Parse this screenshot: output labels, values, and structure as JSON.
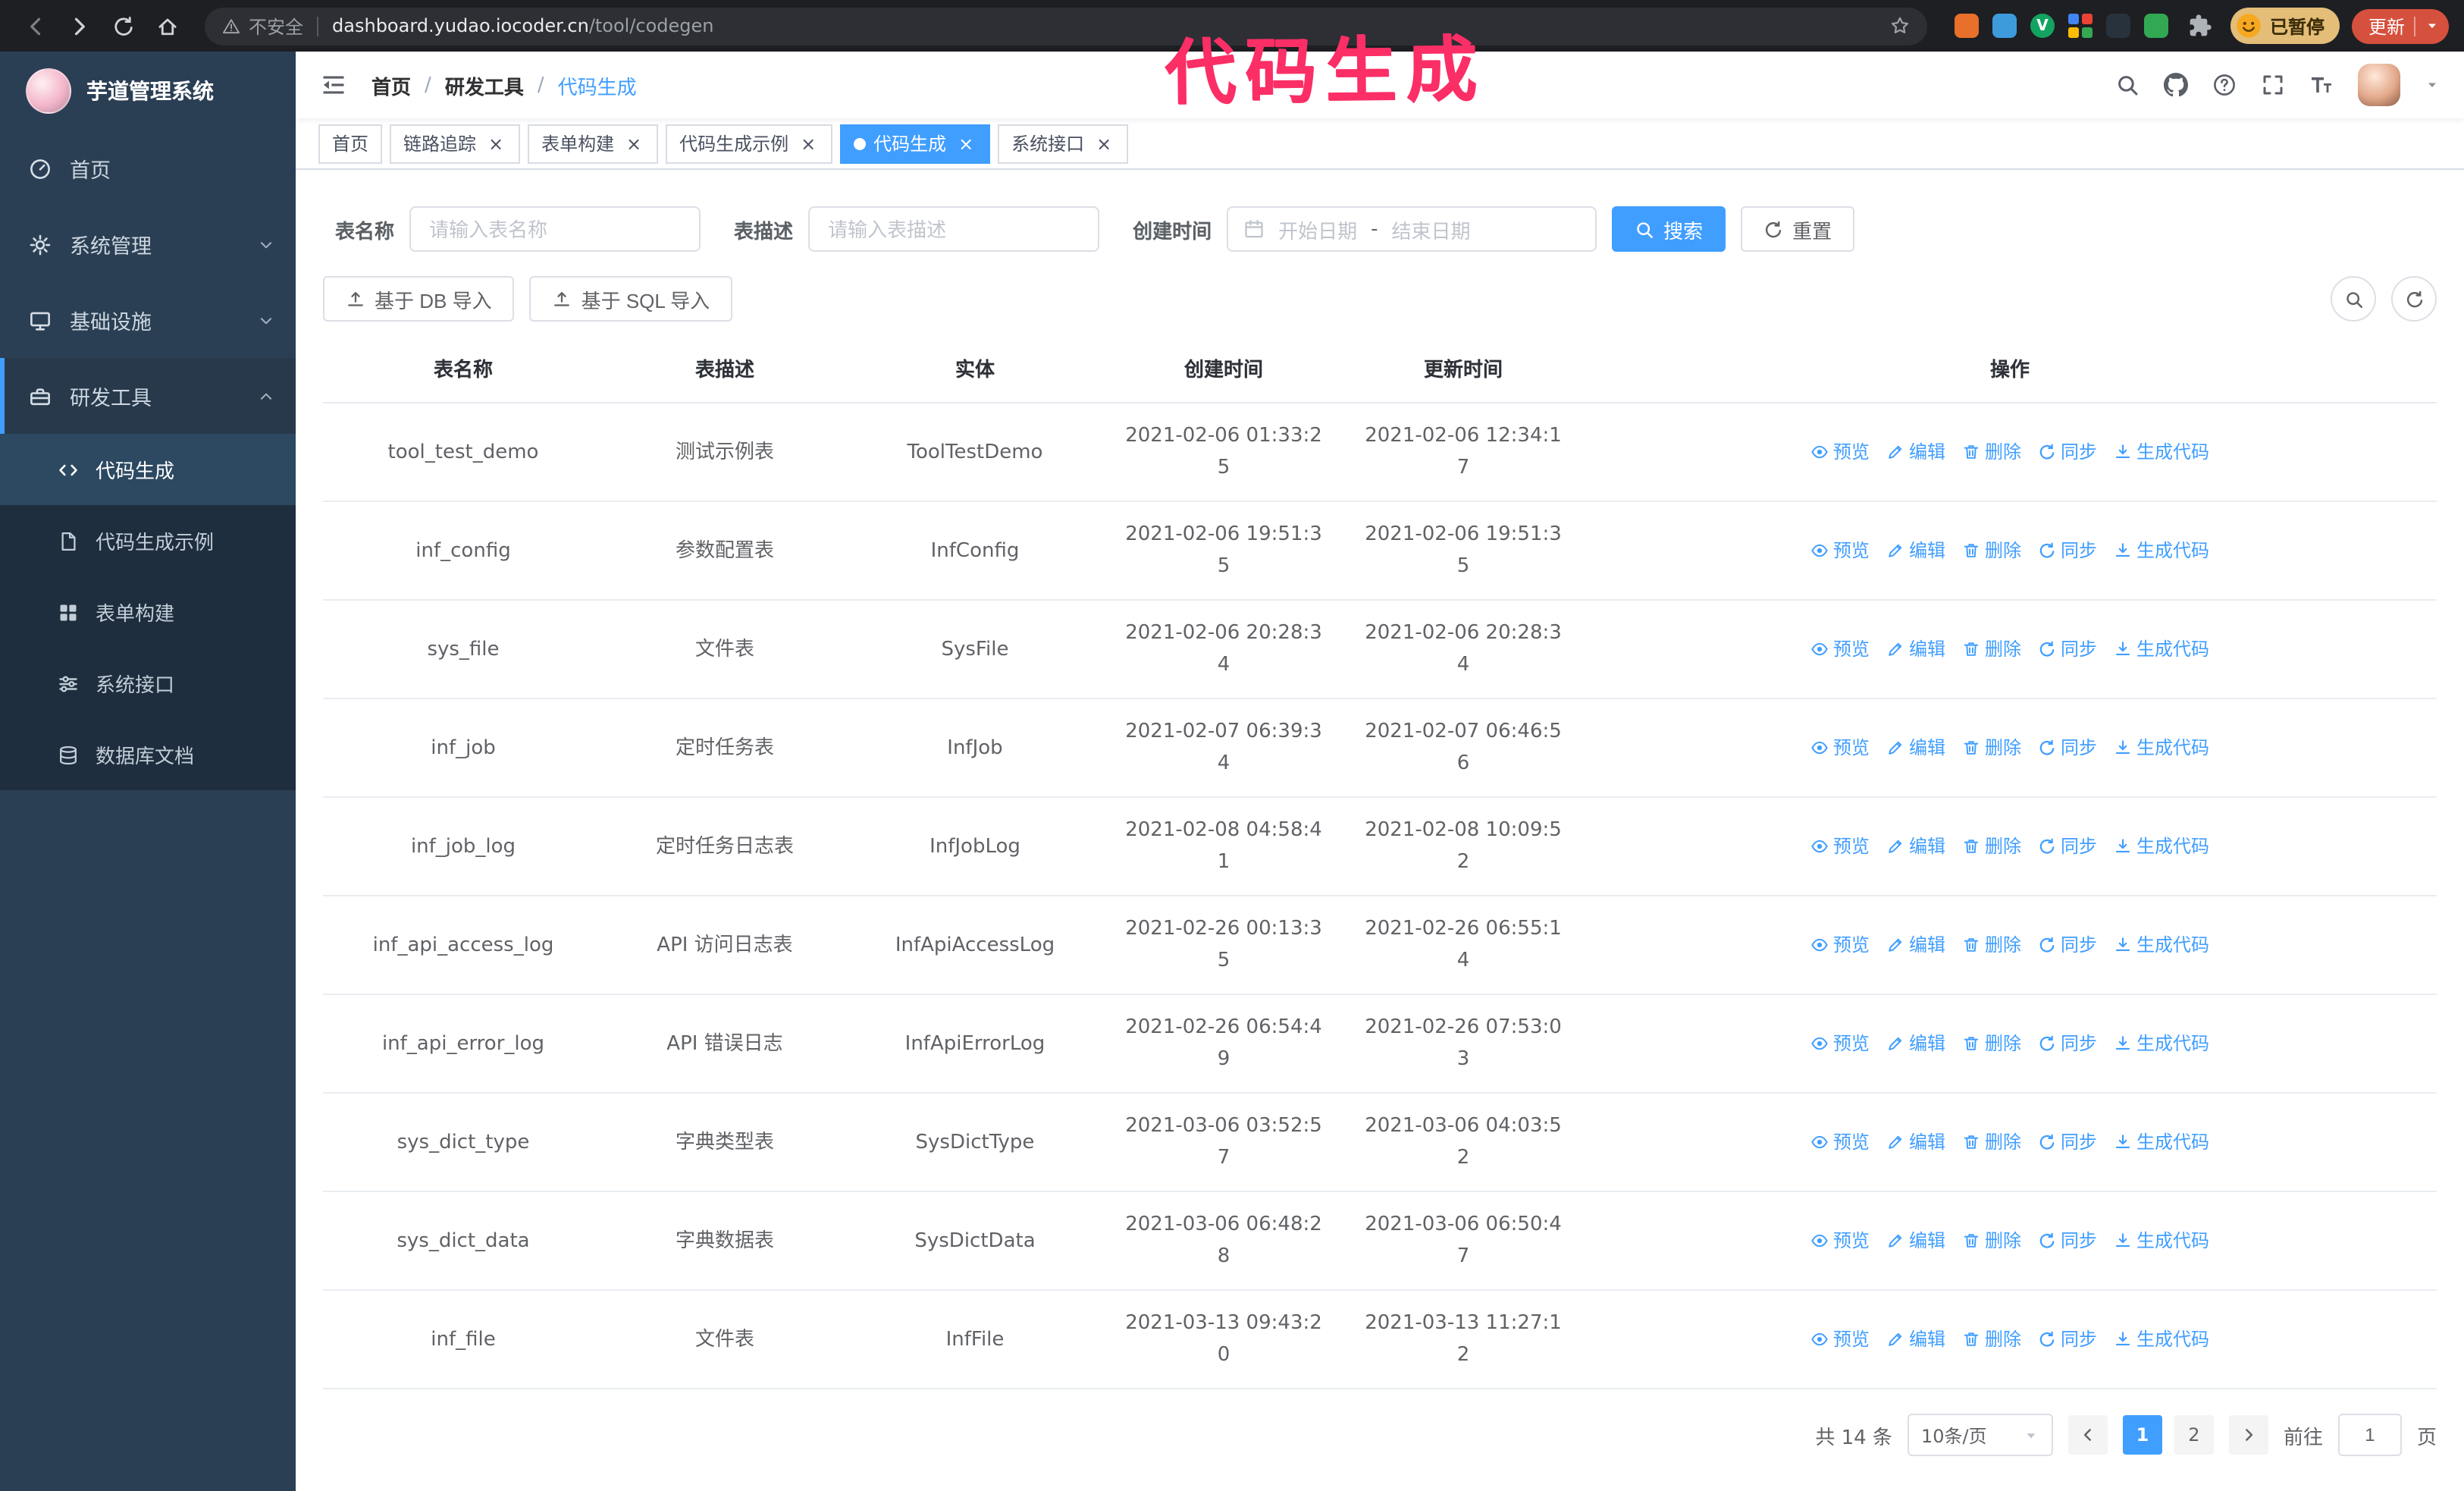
{
  "theme": {
    "accent": "#409eff",
    "sidebar_bg": "#2b3f54",
    "annotation_color": "#fb2e66"
  },
  "annotation": {
    "text": "代码生成"
  },
  "browser": {
    "security_label": "不安全",
    "url_host": "dashboard.yudao.iocoder.cn",
    "url_path": "/tool/codegen",
    "profile_paused_label": "已暂停",
    "update_label": "更新",
    "extensions": [
      {
        "type": "dot",
        "color": "#e8702a"
      },
      {
        "type": "dot",
        "color": "#3d9bdc"
      },
      {
        "type": "badge",
        "color": "#13a361",
        "text": "V"
      },
      {
        "type": "grid",
        "colors": [
          "#4285f4",
          "#ea4335",
          "#fbbc05",
          "#34a853"
        ]
      },
      {
        "type": "dot",
        "color": "#28323c"
      },
      {
        "type": "dot",
        "color": "#32a852"
      }
    ]
  },
  "sidebar": {
    "logo_title": "芋道管理系统",
    "items": [
      {
        "id": "home",
        "label": "首页",
        "icon": "dashboard"
      },
      {
        "id": "system",
        "label": "系统管理",
        "icon": "gear",
        "chevron": true
      },
      {
        "id": "infra",
        "label": "基础设施",
        "icon": "monitor",
        "chevron": true
      },
      {
        "id": "dev-tools",
        "label": "研发工具",
        "icon": "toolbox",
        "chevron": true,
        "expanded": true
      }
    ],
    "subitems": [
      {
        "id": "codegen",
        "label": "代码生成",
        "icon": "code",
        "active": true
      },
      {
        "id": "codegen-example",
        "label": "代码生成示例",
        "icon": "doc"
      },
      {
        "id": "form-builder",
        "label": "表单构建",
        "icon": "form"
      },
      {
        "id": "system-api",
        "label": "系统接口",
        "icon": "sliders"
      },
      {
        "id": "db-doc",
        "label": "数据库文档",
        "icon": "dbtable"
      }
    ]
  },
  "header": {
    "breadcrumb": [
      "首页",
      "研发工具",
      "代码生成"
    ],
    "separator": "/"
  },
  "tabs": [
    {
      "id": "home",
      "label": "首页"
    },
    {
      "id": "trace",
      "label": "链路追踪",
      "closable": true
    },
    {
      "id": "form-builder",
      "label": "表单构建",
      "closable": true
    },
    {
      "id": "codegen-example",
      "label": "代码生成示例",
      "closable": true
    },
    {
      "id": "codegen",
      "label": "代码生成",
      "closable": true,
      "active": true
    },
    {
      "id": "system-api",
      "label": "系统接口",
      "closable": true
    }
  ],
  "filters": {
    "table_name_label": "表名称",
    "table_name_placeholder": "请输入表名称",
    "table_desc_label": "表描述",
    "table_desc_placeholder": "请输入表描述",
    "create_time_label": "创建时间",
    "date_start_placeholder": "开始日期",
    "date_separator": "-",
    "date_end_placeholder": "结束日期",
    "search_label": "搜索",
    "reset_label": "重置"
  },
  "toolbar": {
    "import_db_label": "基于 DB 导入",
    "import_sql_label": "基于 SQL 导入"
  },
  "table": {
    "columns": [
      {
        "key": "name",
        "label": "表名称"
      },
      {
        "key": "desc",
        "label": "表描述"
      },
      {
        "key": "entity",
        "label": "实体"
      },
      {
        "key": "created",
        "label": "创建时间"
      },
      {
        "key": "updated",
        "label": "更新时间"
      },
      {
        "key": "ops",
        "label": "操作"
      }
    ],
    "actions": [
      {
        "key": "preview",
        "label": "预览",
        "icon": "eye"
      },
      {
        "key": "edit",
        "label": "编辑",
        "icon": "edit"
      },
      {
        "key": "delete",
        "label": "删除",
        "icon": "trash"
      },
      {
        "key": "sync",
        "label": "同步",
        "icon": "refresh"
      },
      {
        "key": "generate",
        "label": "生成代码",
        "icon": "download"
      }
    ],
    "rows": [
      {
        "name": "tool_test_demo",
        "desc": "测试示例表",
        "entity": "ToolTestDemo",
        "created": "2021-02-06 01:33:25",
        "updated": "2021-02-06 12:34:17"
      },
      {
        "name": "inf_config",
        "desc": "参数配置表",
        "entity": "InfConfig",
        "created": "2021-02-06 19:51:35",
        "updated": "2021-02-06 19:51:35"
      },
      {
        "name": "sys_file",
        "desc": "文件表",
        "entity": "SysFile",
        "created": "2021-02-06 20:28:34",
        "updated": "2021-02-06 20:28:34"
      },
      {
        "name": "inf_job",
        "desc": "定时任务表",
        "entity": "InfJob",
        "created": "2021-02-07 06:39:34",
        "updated": "2021-02-07 06:46:56"
      },
      {
        "name": "inf_job_log",
        "desc": "定时任务日志表",
        "entity": "InfJobLog",
        "created": "2021-02-08 04:58:41",
        "updated": "2021-02-08 10:09:52"
      },
      {
        "name": "inf_api_access_log",
        "desc": "API 访问日志表",
        "entity": "InfApiAccessLog",
        "created": "2021-02-26 00:13:35",
        "updated": "2021-02-26 06:55:14"
      },
      {
        "name": "inf_api_error_log",
        "desc": "API 错误日志",
        "entity": "InfApiErrorLog",
        "created": "2021-02-26 06:54:49",
        "updated": "2021-02-26 07:53:03"
      },
      {
        "name": "sys_dict_type",
        "desc": "字典类型表",
        "entity": "SysDictType",
        "created": "2021-03-06 03:52:57",
        "updated": "2021-03-06 04:03:52"
      },
      {
        "name": "sys_dict_data",
        "desc": "字典数据表",
        "entity": "SysDictData",
        "created": "2021-03-06 06:48:28",
        "updated": "2021-03-06 06:50:47"
      },
      {
        "name": "inf_file",
        "desc": "文件表",
        "entity": "InfFile",
        "created": "2021-03-13 09:43:20",
        "updated": "2021-03-13 11:27:12"
      }
    ]
  },
  "pagination": {
    "total_label": "共 14 条",
    "page_size_label": "10条/页",
    "pages": [
      "1",
      "2"
    ],
    "active_page": "1",
    "goto_label": "前往",
    "goto_value": "1",
    "goto_unit_label": "页"
  }
}
